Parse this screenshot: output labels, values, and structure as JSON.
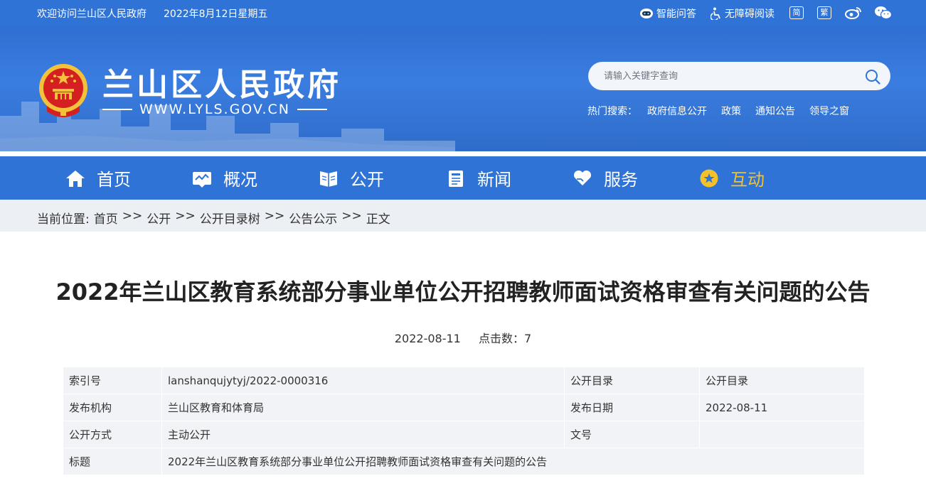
{
  "topbar": {
    "welcome": "欢迎访问兰山区人民政府",
    "date": "2022年8月12日星期五",
    "robot_label": "智能问答",
    "access_label": "无障碍阅读",
    "simplified": "简",
    "traditional": "繁"
  },
  "header": {
    "title": "兰山区人民政府",
    "url": "WWW.LYLS.GOV.CN",
    "search_placeholder": "请输入关键字查询",
    "hot_label": "热门搜索：",
    "hot_items": [
      "政府信息公开",
      "政策",
      "通知公告",
      "领导之窗"
    ]
  },
  "nav": {
    "items": [
      {
        "label": "首页",
        "icon": "home-icon"
      },
      {
        "label": "概况",
        "icon": "overview-icon"
      },
      {
        "label": "公开",
        "icon": "book-icon"
      },
      {
        "label": "新闻",
        "icon": "news-icon"
      },
      {
        "label": "服务",
        "icon": "heart-hand-icon"
      },
      {
        "label": "互动",
        "icon": "star-badge-icon"
      }
    ],
    "active_index": 5,
    "active_color": "#f5c12b"
  },
  "breadcrumb": {
    "prefix": "当前位置:",
    "items": [
      "首页",
      "公开",
      "公开目录树",
      "公告公示",
      "正文"
    ],
    "separator": ">>"
  },
  "article": {
    "title": "2022年兰山区教育系统部分事业单位公开招聘教师面试资格审查有关问题的公告",
    "date": "2022-08-11",
    "clicks": "点击数：7"
  },
  "info": {
    "index_label": "索引号",
    "index_value": "lanshanqujytyj/2022-0000316",
    "catalog_label": "公开目录",
    "catalog_value": "公开目录",
    "org_label": "发布机构",
    "org_value": "兰山区教育和体育局",
    "pubdate_label": "发布日期",
    "pubdate_value": "2022-08-11",
    "mode_label": "公开方式",
    "mode_value": "主动公开",
    "docno_label": "文号",
    "docno_value": "",
    "title_label": "标题",
    "title_value": "2022年兰山区教育系统部分事业单位公开招聘教师面试资格审查有关问题的公告"
  },
  "colors": {
    "primary": "#2f73d6",
    "accent": "#f5c12b",
    "emblem_red": "#d42020"
  }
}
